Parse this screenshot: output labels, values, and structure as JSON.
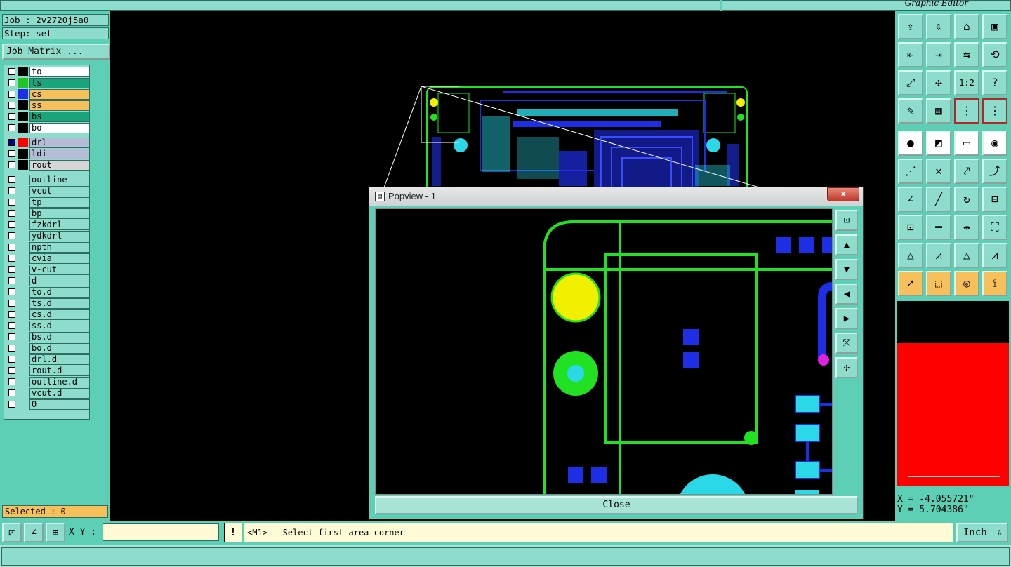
{
  "topbar": {
    "app_title": "Graphic Editor"
  },
  "left": {
    "job": "Job : 2v2720j5a0",
    "step": "Step: set",
    "job_matrix": "Job Matrix ...",
    "layers": [
      {
        "name": "to",
        "color": "#000000",
        "bg": "#ffffff",
        "checked": false
      },
      {
        "name": "ts",
        "color": "#22c422",
        "bg": "#1aa67a",
        "checked": false
      },
      {
        "name": "cs",
        "color": "#1e2ee6",
        "bg": "#f7c05a",
        "checked": false
      },
      {
        "name": "ss",
        "color": "#000000",
        "bg": "#f7c05a",
        "checked": false
      },
      {
        "name": "bs",
        "color": "#000000",
        "bg": "#1aa67a",
        "checked": false
      },
      {
        "name": "bo",
        "color": "#000000",
        "bg": "#ffffff",
        "checked": false
      },
      {
        "name": "drl",
        "color": "#ff0000",
        "bg": "#b5bdd6",
        "checked": true
      },
      {
        "name": "ldi",
        "color": "#000000",
        "bg": "#b5bdd6",
        "checked": false
      },
      {
        "name": "rout",
        "color": "#000000",
        "bg": "#d6d6d6",
        "checked": false
      },
      {
        "name": "outline",
        "color": "",
        "bg": "#8edccb",
        "checked": false
      },
      {
        "name": "vcut",
        "color": "",
        "bg": "#8edccb",
        "checked": false
      },
      {
        "name": "tp",
        "color": "",
        "bg": "#8edccb",
        "checked": false
      },
      {
        "name": "bp",
        "color": "",
        "bg": "#8edccb",
        "checked": false
      },
      {
        "name": "fzkdrl",
        "color": "",
        "bg": "#8edccb",
        "checked": false
      },
      {
        "name": "ydkdrl",
        "color": "",
        "bg": "#8edccb",
        "checked": false
      },
      {
        "name": "npth",
        "color": "",
        "bg": "#8edccb",
        "checked": false
      },
      {
        "name": "cvia",
        "color": "",
        "bg": "#8edccb",
        "checked": false
      },
      {
        "name": "v-cut",
        "color": "",
        "bg": "#8edccb",
        "checked": false
      },
      {
        "name": "d",
        "color": "",
        "bg": "#8edccb",
        "checked": false
      },
      {
        "name": "to.d",
        "color": "",
        "bg": "#8edccb",
        "checked": false
      },
      {
        "name": "ts.d",
        "color": "",
        "bg": "#8edccb",
        "checked": false
      },
      {
        "name": "cs.d",
        "color": "",
        "bg": "#8edccb",
        "checked": false
      },
      {
        "name": "ss.d",
        "color": "",
        "bg": "#8edccb",
        "checked": false
      },
      {
        "name": "bs.d",
        "color": "",
        "bg": "#8edccb",
        "checked": false
      },
      {
        "name": "bo.d",
        "color": "",
        "bg": "#8edccb",
        "checked": false
      },
      {
        "name": "drl.d",
        "color": "",
        "bg": "#8edccb",
        "checked": false
      },
      {
        "name": "rout.d",
        "color": "",
        "bg": "#8edccb",
        "checked": false
      },
      {
        "name": "outline.d",
        "color": "",
        "bg": "#8edccb",
        "checked": false
      },
      {
        "name": "vcut.d",
        "color": "",
        "bg": "#8edccb",
        "checked": false
      },
      {
        "name": "0",
        "color": "",
        "bg": "#8edccb",
        "checked": false
      }
    ],
    "selected": "Selected : 0"
  },
  "popview": {
    "title": "Popview - 1",
    "close_x": "x",
    "close_label": "Close"
  },
  "right": {
    "tools": [
      "export-icon",
      "import-icon",
      "home-icon",
      "window-icon",
      "arrow-left-icon",
      "arrow-right-icon",
      "mirror-icon",
      "rotate-icon",
      "fit-icon",
      "zoom-icon",
      "scale-1-2-icon",
      "help-icon",
      "edit-icon",
      "grid-icon",
      "layer-snap-icon",
      "layer-snap-2-icon",
      "circle-select-icon",
      "line-select-icon",
      "ruler-icon",
      "dot-icon",
      "network-icon",
      "cross-icon",
      "connect-icon",
      "route-icon",
      "angle-icon",
      "line-icon",
      "arc-icon",
      "pad-icon",
      "target-icon",
      "trace-icon",
      "measure-icon",
      "shape-icon",
      "triangle-icon",
      "triangle-2-icon",
      "triangle-3-icon",
      "triangle-4-icon",
      "pointer-icon",
      "pointer-box-icon",
      "pointer-circle-icon",
      "pointer-path-icon"
    ],
    "x_coord": "X = -4.055721\"",
    "y_coord": "Y = 5.704386\""
  },
  "bottom": {
    "xy_label": "X Y :",
    "xy_value": "",
    "bang": "!",
    "prompt": "<M1> - Select first area corner",
    "units": "Inch"
  }
}
